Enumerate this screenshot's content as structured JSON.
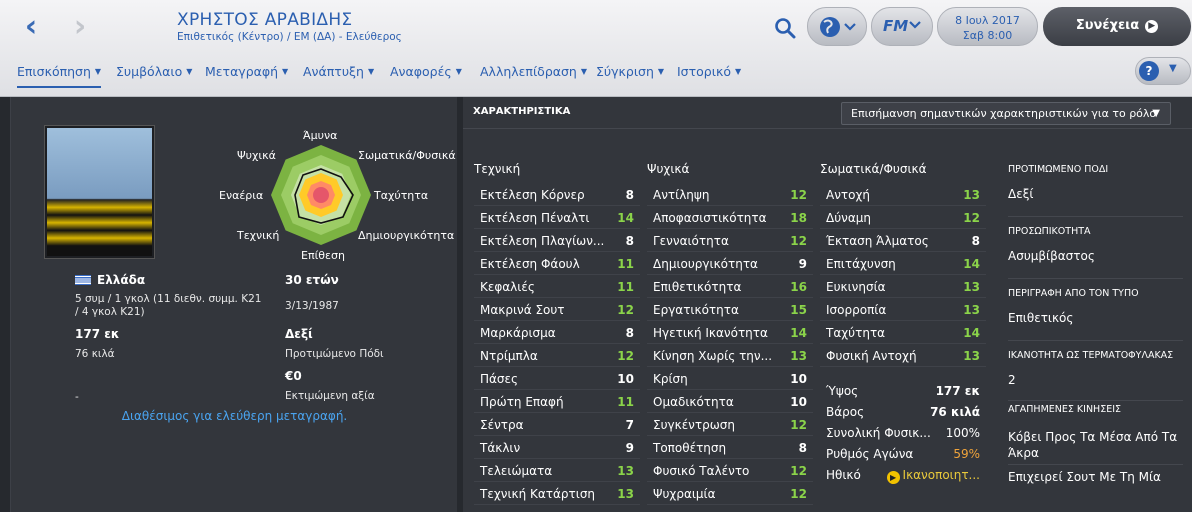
{
  "header": {
    "player_name": "ΧΡΗΣΤΟΣ ΑΡΑΒΙΔΗΣ",
    "subtitle": "Επιθετικός (Κέντρο) / ΕΜ (ΔΑ) - Ελεύθερος",
    "date": "8 Ιουλ 2017",
    "time": "Σαβ 8:00",
    "continue_label": "Συνέχεια",
    "fm_label": "FM"
  },
  "tabs": [
    {
      "label": "Επισκόπηση",
      "active": true
    },
    {
      "label": "Συμβόλαιο"
    },
    {
      "label": "Μεταγραφή"
    },
    {
      "label": "Ανάπτυξη"
    },
    {
      "label": "Αναφορές"
    },
    {
      "label": "Αλληλεπίδραση"
    },
    {
      "label": "Σύγκριση"
    },
    {
      "label": "Ιστορικό"
    }
  ],
  "help_label": "?",
  "radar": {
    "labels": [
      "Άμυνα",
      "Σωματικά/Φυσικά",
      "Ταχύτητα",
      "Δημιουργικότητα",
      "Επίθεση",
      "Τεχνική",
      "Εναέρια",
      "Ψυχικά"
    ]
  },
  "profile": {
    "nationality": "Ελλάδα",
    "caps": "5 συμ / 1 γκολ (11 διεθν. συμμ. Κ21 / 4 γκολ Κ21)",
    "age": "30 ετών",
    "dob": "3/13/1987",
    "height": "177 εκ",
    "weight": "76 κιλά",
    "foot": "Δεξί",
    "foot_label": "Προτιμώμενο Πόδι",
    "value": "€0",
    "value_label": "Εκτιμώμενη αξία",
    "dash": "-",
    "availability": "Διαθέσιμος για ελεύθερη μεταγραφή."
  },
  "attributes_title": "ΧΑΡΑΚΤΗΡΙΣΤΙΚΑ",
  "highlight_select": "Επισήμανση σημαντικών χαρακτηριστικών για το ρόλο",
  "technical": {
    "title": "Τεχνική",
    "items": [
      {
        "name": "Εκτέλεση Κόρνερ",
        "value": "8"
      },
      {
        "name": "Εκτέλεση Πέναλτι",
        "value": "14"
      },
      {
        "name": "Εκτέλεση Πλαγίων...",
        "value": "8"
      },
      {
        "name": "Εκτέλεση Φάουλ",
        "value": "11"
      },
      {
        "name": "Κεφαλιές",
        "value": "11"
      },
      {
        "name": "Μακρινά Σουτ",
        "value": "12"
      },
      {
        "name": "Μαρκάρισμα",
        "value": "8"
      },
      {
        "name": "Ντρίμπλα",
        "value": "12"
      },
      {
        "name": "Πάσες",
        "value": "10"
      },
      {
        "name": "Πρώτη Επαφή",
        "value": "11"
      },
      {
        "name": "Σέντρα",
        "value": "7"
      },
      {
        "name": "Τάκλιν",
        "value": "9"
      },
      {
        "name": "Τελειώματα",
        "value": "13"
      },
      {
        "name": "Τεχνική Κατάρτιση",
        "value": "13"
      }
    ]
  },
  "mental": {
    "title": "Ψυχικά",
    "items": [
      {
        "name": "Αντίληψη",
        "value": "12"
      },
      {
        "name": "Αποφασιστικότητα",
        "value": "18"
      },
      {
        "name": "Γενναιότητα",
        "value": "12"
      },
      {
        "name": "Δημιουργικότητα",
        "value": "9"
      },
      {
        "name": "Επιθετικότητα",
        "value": "16"
      },
      {
        "name": "Εργατικότητα",
        "value": "15"
      },
      {
        "name": "Ηγετική Ικανότητα",
        "value": "14"
      },
      {
        "name": "Κίνηση Χωρίς την...",
        "value": "13"
      },
      {
        "name": "Κρίση",
        "value": "10"
      },
      {
        "name": "Ομαδικότητα",
        "value": "10"
      },
      {
        "name": "Συγκέντρωση",
        "value": "12"
      },
      {
        "name": "Τοποθέτηση",
        "value": "8"
      },
      {
        "name": "Φυσικό Ταλέντο",
        "value": "12"
      },
      {
        "name": "Ψυχραιμία",
        "value": "12"
      }
    ]
  },
  "physical": {
    "title": "Σωματικά/Φυσικά",
    "items": [
      {
        "name": "Αντοχή",
        "value": "13"
      },
      {
        "name": "Δύναμη",
        "value": "12"
      },
      {
        "name": "Έκταση Άλματος",
        "value": "8"
      },
      {
        "name": "Επιτάχυνση",
        "value": "14"
      },
      {
        "name": "Ευκινησία",
        "value": "13"
      },
      {
        "name": "Ισορροπία",
        "value": "13"
      },
      {
        "name": "Ταχύτητα",
        "value": "14"
      },
      {
        "name": "Φυσική Αντοχή",
        "value": "13"
      }
    ],
    "extra": [
      {
        "name": "Ύψος",
        "value": "177 εκ"
      },
      {
        "name": "Βάρος",
        "value": "76 κιλά"
      },
      {
        "name": "Συνολική Φυσικ...",
        "value": "100%"
      },
      {
        "name": "Ρυθμός Αγώνα",
        "value": "59%"
      },
      {
        "name": "Ηθικό",
        "value": "Ικανοποιητ..."
      }
    ]
  },
  "info": {
    "foot_header": "ΠΡΟΤΙΜΩΜΕΝΟ ΠΟΔΙ",
    "foot_value": "Δεξί",
    "personality_header": "ΠΡΟΣΩΠΙΚΟΤΗΤΑ",
    "personality_value": "Ασυμβίβαστος",
    "media_header": "ΠΕΡΙΓΡΑΦΗ ΑΠΟ ΤΟΝ ΤΥΠΟ",
    "media_value": "Επιθετικός",
    "gk_header": "ΙΚΑΝΟΤΗΤΑ ΩΣ ΤΕΡΜΑΤΟΦΥΛΑΚΑΣ",
    "gk_value": "2",
    "moves_header": "ΑΓΑΠΗΜΕΝΕΣ ΚΙΝΗΣΕΙΣ",
    "move_1": "Κόβει Προς Τα Μέσα Από Τα Άκρα",
    "move_2": "Επιχειρεί Σουτ Με Τη Μία"
  },
  "colors": {
    "accent": "#2b5fb0",
    "good": "#8bd44a",
    "warn": "#f0a43b",
    "link": "#4aa4f0"
  }
}
